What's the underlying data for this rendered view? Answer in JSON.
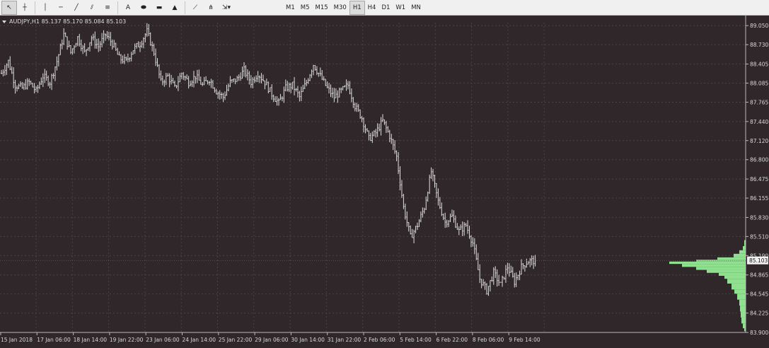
{
  "toolbar": {
    "tools": [
      {
        "name": "cursor-icon",
        "glyph": "↖",
        "active": true
      },
      {
        "name": "crosshair-icon",
        "glyph": "┼",
        "active": false
      },
      {
        "name": "vertical-line-icon",
        "glyph": "│",
        "active": false
      },
      {
        "name": "horizontal-line-icon",
        "glyph": "─",
        "active": false
      },
      {
        "name": "trendline-icon",
        "glyph": "╱",
        "active": false
      },
      {
        "name": "equidistant-channel-icon",
        "glyph": "⫽",
        "active": false
      },
      {
        "name": "fibonacci-retracement-icon",
        "glyph": "≡",
        "active": false
      },
      {
        "name": "text-icon",
        "glyph": "A",
        "active": false
      },
      {
        "name": "ellipse-icon",
        "glyph": "⬬",
        "active": false
      },
      {
        "name": "rectangle-icon",
        "glyph": "▬",
        "active": false
      },
      {
        "name": "triangle-icon",
        "glyph": "▲",
        "active": false
      },
      {
        "name": "fibonacci-fan-icon",
        "glyph": "⟋",
        "active": false
      },
      {
        "name": "andrews-pitchfork-icon",
        "glyph": "⋔",
        "active": false
      },
      {
        "name": "arrows-dropdown-icon",
        "glyph": "⇲▾",
        "active": false
      }
    ],
    "timeframes": [
      "M1",
      "M5",
      "M15",
      "M30",
      "H1",
      "H4",
      "D1",
      "W1",
      "MN"
    ],
    "active_timeframe": "H1"
  },
  "symbol_label": "AUDJPY,H1  85.137 85.170 85.084 85.103",
  "current_price_label": "85.103",
  "colors": {
    "background": "#2f2729",
    "candles": "#e0e0e0",
    "grid": "#4a4244",
    "volume_profile": "#8fe08f",
    "price_label_bg": "#f0f0f0"
  },
  "chart_data": {
    "type": "candlestick",
    "symbol": "AUDJPY",
    "timeframe": "H1",
    "last_bar": {
      "open": 85.137,
      "high": 85.17,
      "low": 85.084,
      "close": 85.103
    },
    "ylim": [
      83.9,
      89.1
    ],
    "y_ticks": [
      "89.050",
      "88.730",
      "88.405",
      "88.085",
      "87.765",
      "87.440",
      "87.120",
      "86.800",
      "86.475",
      "86.155",
      "85.830",
      "85.510",
      "85.190",
      "84.865",
      "84.545",
      "84.225",
      "83.900"
    ],
    "x_ticks": [
      "15 Jan 2018",
      "17 Jan 06:00",
      "18 Jan 14:00",
      "19 Jan 22:00",
      "23 Jan 06:00",
      "24 Jan 14:00",
      "25 Jan 22:00",
      "29 Jan 06:00",
      "30 Jan 14:00",
      "31 Jan 22:00",
      "2 Feb 06:00",
      "5 Feb 14:00",
      "6 Feb 22:00",
      "8 Feb 06:00",
      "9 Feb 14:00"
    ],
    "price_path": [
      [
        0,
        88.25
      ],
      [
        4,
        88.45
      ],
      [
        8,
        88.05
      ],
      [
        12,
        88.0
      ],
      [
        16,
        88.1
      ],
      [
        20,
        87.95
      ],
      [
        24,
        88.2
      ],
      [
        28,
        88.1
      ],
      [
        32,
        88.45
      ],
      [
        36,
        88.9
      ],
      [
        40,
        88.6
      ],
      [
        44,
        88.85
      ],
      [
        48,
        88.6
      ],
      [
        52,
        88.85
      ],
      [
        56,
        88.7
      ],
      [
        60,
        88.9
      ],
      [
        64,
        88.75
      ],
      [
        68,
        88.5
      ],
      [
        72,
        88.45
      ],
      [
        76,
        88.65
      ],
      [
        80,
        88.75
      ],
      [
        84,
        88.95
      ],
      [
        88,
        88.6
      ],
      [
        92,
        88.1
      ],
      [
        96,
        88.2
      ],
      [
        100,
        88.0
      ],
      [
        104,
        88.25
      ],
      [
        108,
        88.1
      ],
      [
        112,
        88.2
      ],
      [
        116,
        88.05
      ],
      [
        120,
        88.15
      ],
      [
        124,
        87.95
      ],
      [
        128,
        87.85
      ],
      [
        132,
        88.1
      ],
      [
        136,
        88.15
      ],
      [
        140,
        88.3
      ],
      [
        144,
        88.1
      ],
      [
        148,
        88.25
      ],
      [
        152,
        88.1
      ],
      [
        156,
        87.9
      ],
      [
        160,
        87.75
      ],
      [
        164,
        88.0
      ],
      [
        168,
        88.05
      ],
      [
        172,
        87.85
      ],
      [
        176,
        88.1
      ],
      [
        180,
        88.4
      ],
      [
        184,
        88.2
      ],
      [
        188,
        88.0
      ],
      [
        192,
        87.85
      ],
      [
        196,
        87.95
      ],
      [
        200,
        88.05
      ],
      [
        204,
        87.7
      ],
      [
        208,
        87.5
      ],
      [
        212,
        87.15
      ],
      [
        216,
        87.25
      ],
      [
        220,
        87.45
      ],
      [
        224,
        87.2
      ],
      [
        228,
        86.85
      ],
      [
        232,
        86.0
      ],
      [
        236,
        85.5
      ],
      [
        240,
        85.7
      ],
      [
        244,
        86.0
      ],
      [
        248,
        86.6
      ],
      [
        252,
        86.1
      ],
      [
        256,
        85.75
      ],
      [
        260,
        85.85
      ],
      [
        264,
        85.6
      ],
      [
        268,
        85.7
      ],
      [
        272,
        85.4
      ],
      [
        276,
        84.8
      ],
      [
        280,
        84.6
      ],
      [
        284,
        84.9
      ],
      [
        288,
        84.7
      ],
      [
        292,
        85.0
      ],
      [
        296,
        84.75
      ],
      [
        300,
        85.0
      ],
      [
        304,
        85.1
      ],
      [
        308,
        85.103
      ]
    ],
    "volume_profile": [
      [
        85.45,
        2
      ],
      [
        85.35,
        4
      ],
      [
        85.28,
        9
      ],
      [
        85.22,
        17
      ],
      [
        85.16,
        40
      ],
      [
        85.12,
        70
      ],
      [
        85.09,
        108
      ],
      [
        85.05,
        90
      ],
      [
        85.0,
        70
      ],
      [
        84.95,
        55
      ],
      [
        84.9,
        38
      ],
      [
        84.85,
        30
      ],
      [
        84.8,
        26
      ],
      [
        84.72,
        20
      ],
      [
        84.62,
        16
      ],
      [
        84.55,
        12
      ],
      [
        84.45,
        9
      ],
      [
        84.35,
        8
      ],
      [
        84.25,
        7
      ],
      [
        84.15,
        6
      ],
      [
        84.05,
        4
      ],
      [
        83.97,
        2
      ]
    ]
  }
}
